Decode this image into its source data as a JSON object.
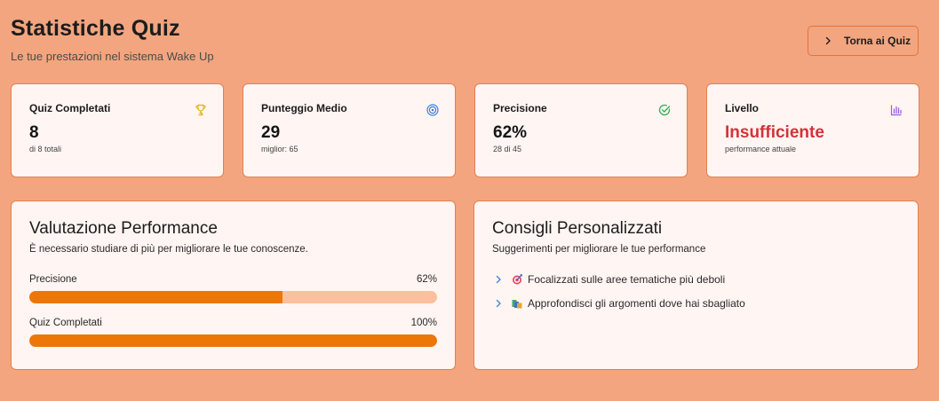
{
  "header": {
    "title": "Statistiche Quiz",
    "subtitle": "Le tue prestazioni nel sistema Wake Up",
    "back_button_label": "Torna ai Quiz"
  },
  "stats": [
    {
      "title": "Quiz Completati",
      "value": "8",
      "sub": "di 8 totali",
      "icon": "trophy-icon",
      "icon_color": "#e0b21c"
    },
    {
      "title": "Punteggio Medio",
      "value": "29",
      "sub": "miglior: 65",
      "icon": "target-icon",
      "icon_color": "#3f7fd9"
    },
    {
      "title": "Precisione",
      "value": "62%",
      "sub": "28 di 45",
      "icon": "check-circle-icon",
      "icon_color": "#2fae4f"
    },
    {
      "title": "Livello",
      "value": "Insufficiente",
      "sub": "performance attuale",
      "icon": "bar-chart-icon",
      "icon_color": "#9b5de5",
      "value_color": "#d1343a"
    }
  ],
  "performance": {
    "title": "Valutazione Performance",
    "description": "È necessario studiare di più per migliorare le tue conoscenze.",
    "metrics": [
      {
        "label": "Precisione",
        "percent_label": "62%",
        "fraction": 0.62
      },
      {
        "label": "Quiz Completati",
        "percent_label": "100%",
        "fraction": 1.0
      }
    ]
  },
  "advice": {
    "title": "Consigli Personalizzati",
    "description": "Suggerimenti per migliorare le tue performance",
    "items": [
      {
        "text": "Focalizzati sulle aree tematiche più deboli",
        "icon": "dart-target-icon"
      },
      {
        "text": "Approfondisci gli argomenti dove hai sbagliato",
        "icon": "books-icon"
      }
    ]
  },
  "colors": {
    "background": "#f3a57f",
    "card": "#fff5f2",
    "border": "#e38152",
    "progress_fill": "#ed7608",
    "progress_track": "#fcc09d"
  }
}
